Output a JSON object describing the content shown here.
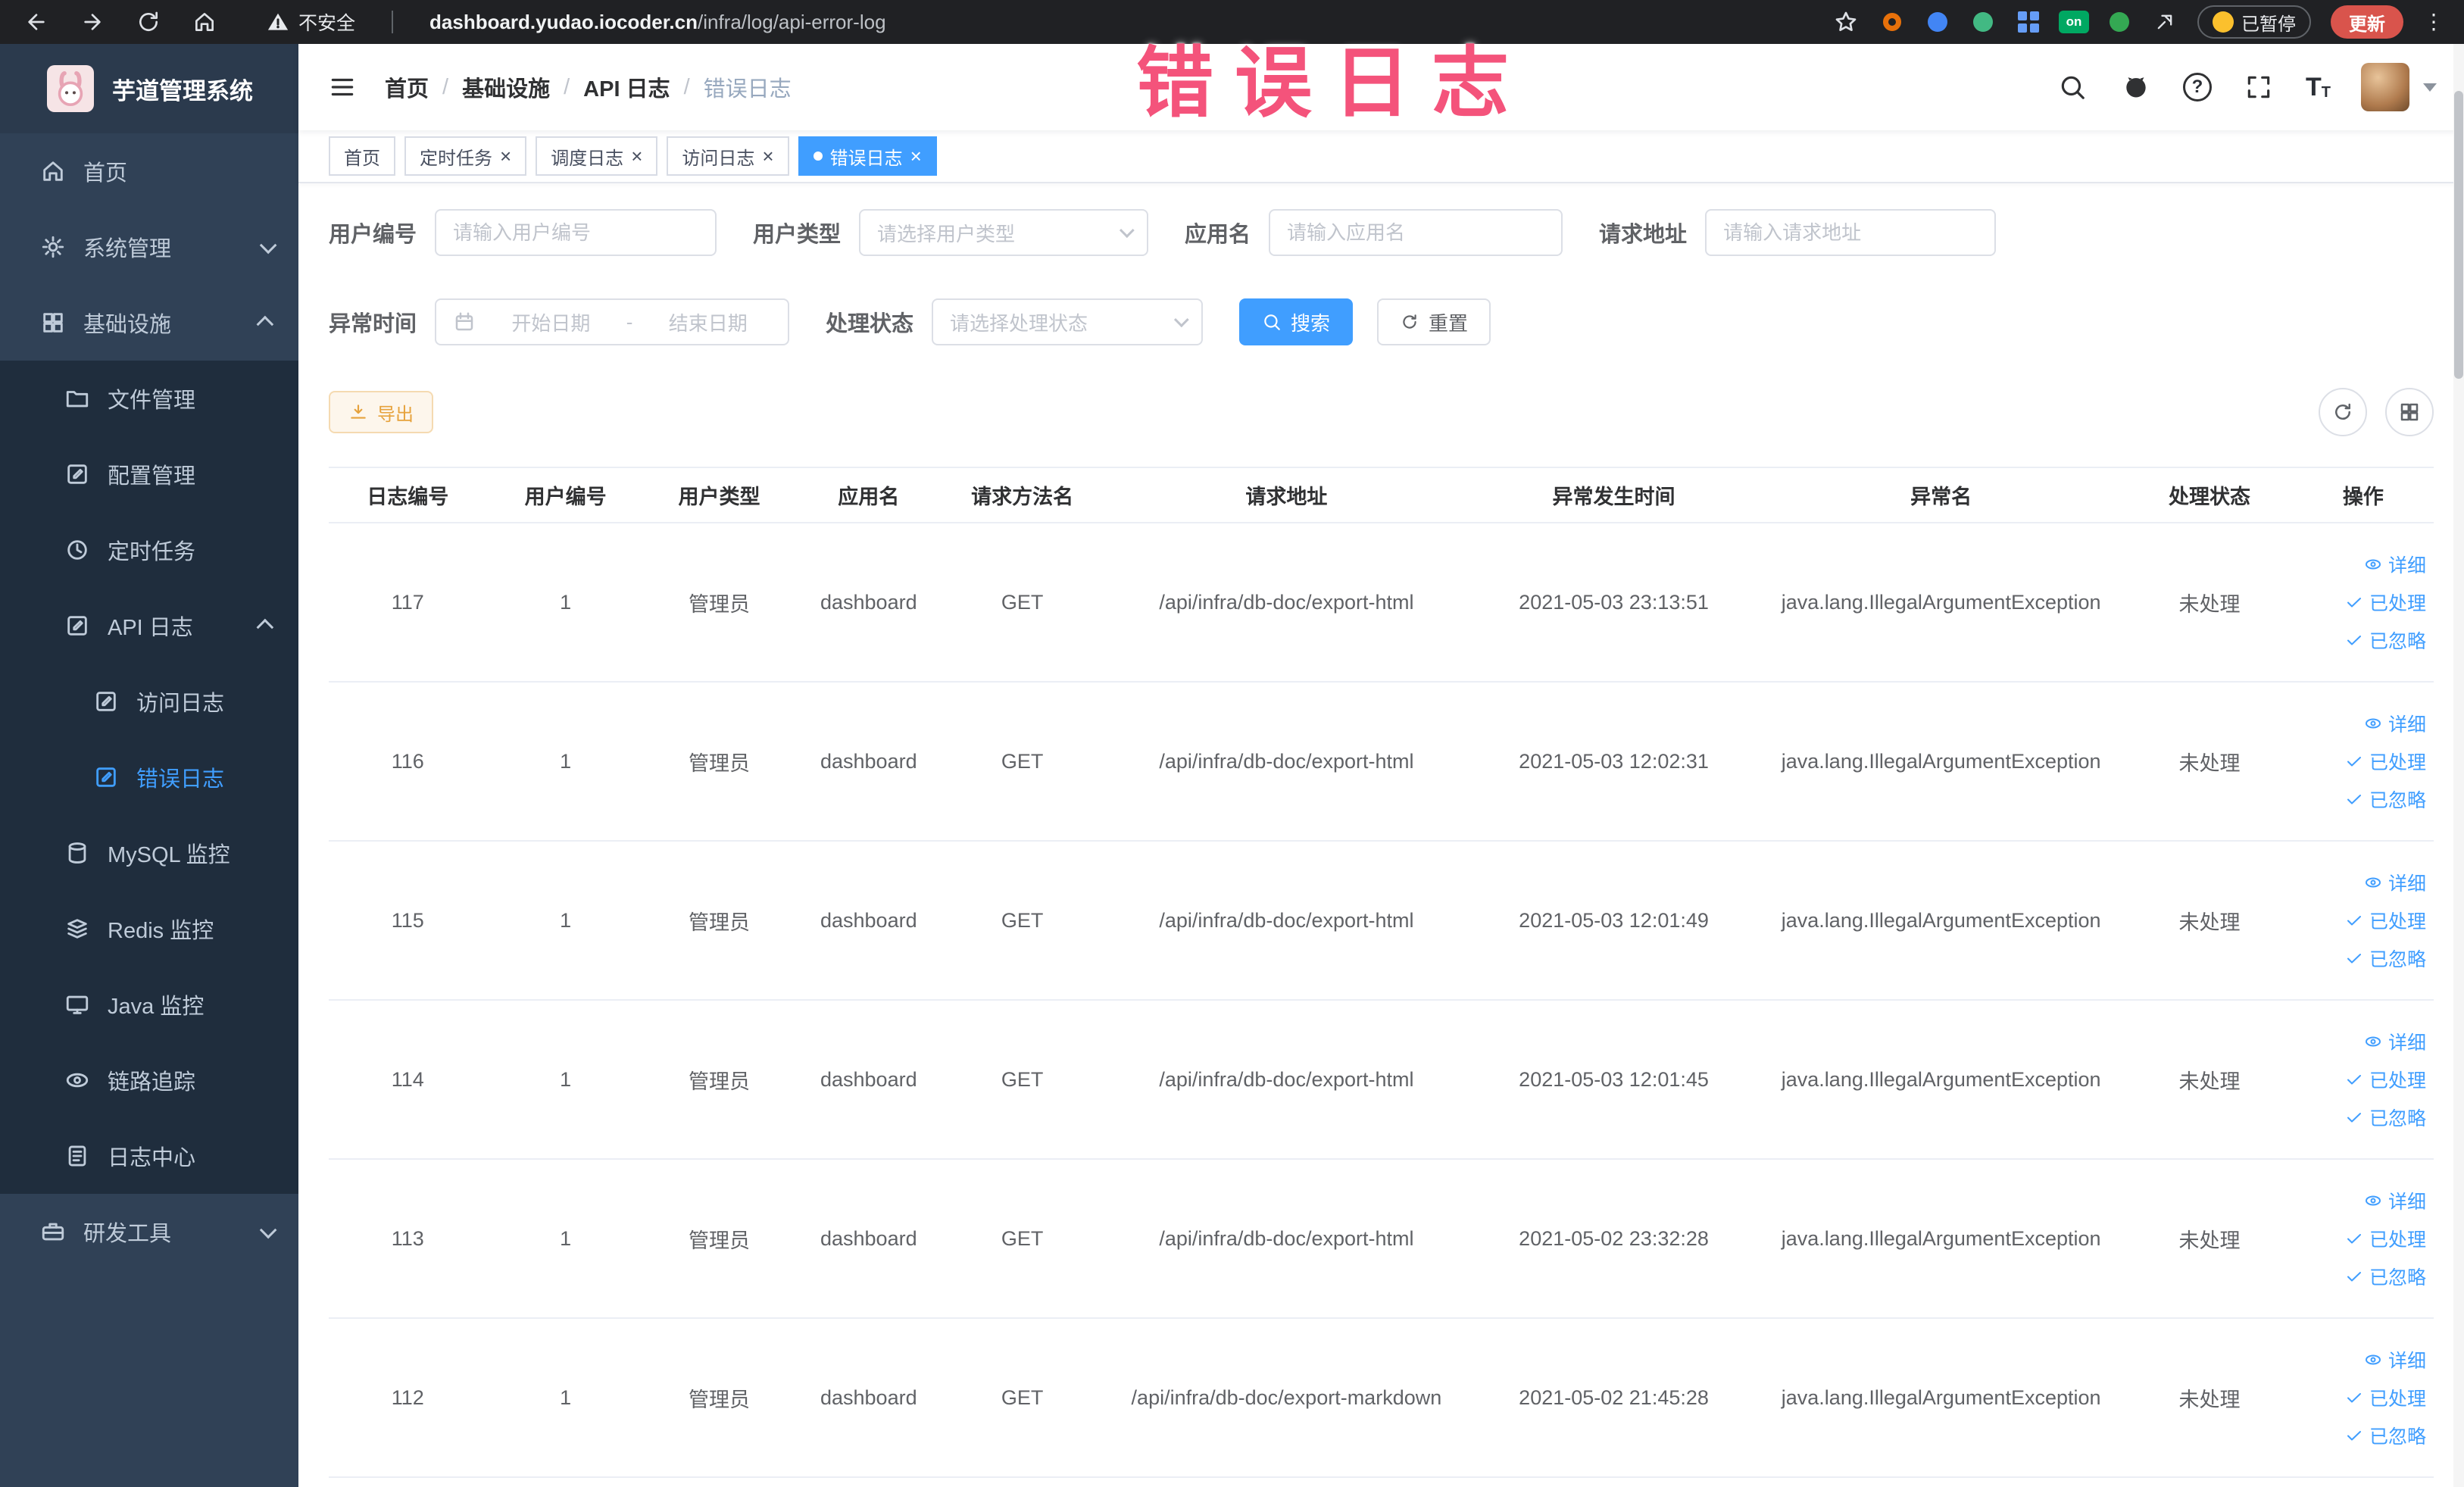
{
  "colors": {
    "accent": "#409eff",
    "sidebar_bg": "#304156",
    "sidebar_submenu_bg": "#1f2d3d",
    "sidebar_text": "#bfcbd9",
    "warning": "#e6a23c",
    "annotation_red": "#f4537b",
    "chrome_bg": "#202124",
    "update_button": "#d9544c",
    "table_border": "#ebeef5"
  },
  "icons": {
    "close": "×",
    "breadcrumb_separator": "/",
    "help": "?",
    "font_glyph": "T",
    "ellipsis": "⋮"
  },
  "browser": {
    "security_label": "不安全",
    "url_domain": "dashboard.yudao.iocoder.cn",
    "url_path": "/infra/log/api-error-log",
    "extension_on_badge": "on",
    "paused_label": "已暂停",
    "update_label": "更新"
  },
  "annotation": {
    "text": "错误日志"
  },
  "sidebar": {
    "logo_title": "芋道管理系统",
    "items": [
      {
        "label": "首页"
      },
      {
        "label": "系统管理"
      },
      {
        "label": "基础设施"
      },
      {
        "label": "文件管理"
      },
      {
        "label": "配置管理"
      },
      {
        "label": "定时任务"
      },
      {
        "label": "API 日志"
      },
      {
        "label": "访问日志"
      },
      {
        "label": "错误日志"
      },
      {
        "label": "MySQL 监控"
      },
      {
        "label": "Redis 监控"
      },
      {
        "label": "Java 监控"
      },
      {
        "label": "链路追踪"
      },
      {
        "label": "日志中心"
      },
      {
        "label": "研发工具"
      }
    ]
  },
  "header": {
    "breadcrumb": [
      "首页",
      "基础设施",
      "API 日志",
      "错误日志"
    ]
  },
  "tabs": [
    {
      "label": "首页"
    },
    {
      "label": "定时任务"
    },
    {
      "label": "调度日志"
    },
    {
      "label": "访问日志"
    },
    {
      "label": "错误日志"
    }
  ],
  "filters": {
    "user_id": {
      "label": "用户编号",
      "placeholder": "请输入用户编号"
    },
    "user_type": {
      "label": "用户类型",
      "placeholder": "请选择用户类型"
    },
    "app_name": {
      "label": "应用名",
      "placeholder": "请输入应用名"
    },
    "request_url": {
      "label": "请求地址",
      "placeholder": "请输入请求地址"
    },
    "exception_time": {
      "label": "异常时间",
      "start_placeholder": "开始日期",
      "separator": "-",
      "end_placeholder": "结束日期"
    },
    "process_status": {
      "label": "处理状态",
      "placeholder": "请选择处理状态"
    },
    "search_label": "搜索",
    "reset_label": "重置"
  },
  "toolbar": {
    "export_label": "导出"
  },
  "table": {
    "headers": [
      "日志编号",
      "用户编号",
      "用户类型",
      "应用名",
      "请求方法名",
      "请求地址",
      "异常发生时间",
      "异常名",
      "处理状态",
      "操作"
    ],
    "actions": [
      "详细",
      "已处理",
      "已忽略"
    ],
    "rows": [
      {
        "id": "117",
        "user_id": "1",
        "user_type": "管理员",
        "app": "dashboard",
        "method": "GET",
        "url": "/api/infra/db-doc/export-html",
        "time": "2021-05-03 23:13:51",
        "exception": "java.lang.IllegalArgumentException",
        "status": "未处理"
      },
      {
        "id": "116",
        "user_id": "1",
        "user_type": "管理员",
        "app": "dashboard",
        "method": "GET",
        "url": "/api/infra/db-doc/export-html",
        "time": "2021-05-03 12:02:31",
        "exception": "java.lang.IllegalArgumentException",
        "status": "未处理"
      },
      {
        "id": "115",
        "user_id": "1",
        "user_type": "管理员",
        "app": "dashboard",
        "method": "GET",
        "url": "/api/infra/db-doc/export-html",
        "time": "2021-05-03 12:01:49",
        "exception": "java.lang.IllegalArgumentException",
        "status": "未处理"
      },
      {
        "id": "114",
        "user_id": "1",
        "user_type": "管理员",
        "app": "dashboard",
        "method": "GET",
        "url": "/api/infra/db-doc/export-html",
        "time": "2021-05-03 12:01:45",
        "exception": "java.lang.IllegalArgumentException",
        "status": "未处理"
      },
      {
        "id": "113",
        "user_id": "1",
        "user_type": "管理员",
        "app": "dashboard",
        "method": "GET",
        "url": "/api/infra/db-doc/export-html",
        "time": "2021-05-02 23:32:28",
        "exception": "java.lang.IllegalArgumentException",
        "status": "未处理"
      },
      {
        "id": "112",
        "user_id": "1",
        "user_type": "管理员",
        "app": "dashboard",
        "method": "GET",
        "url": "/api/infra/db-doc/export-markdown",
        "time": "2021-05-02 21:45:28",
        "exception": "java.lang.IllegalArgumentException",
        "status": "未处理"
      }
    ]
  }
}
